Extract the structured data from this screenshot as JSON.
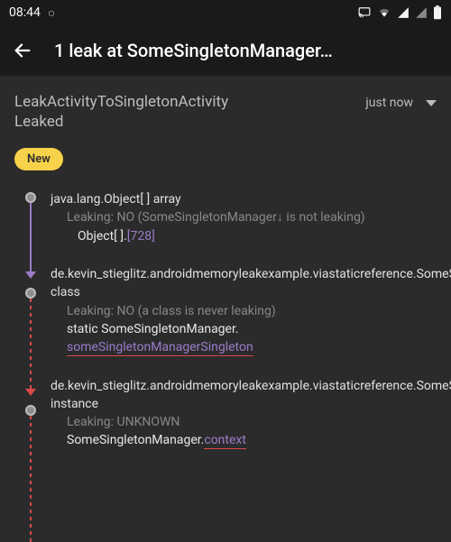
{
  "status": {
    "time": "08:44",
    "dot": "○"
  },
  "appbar": {
    "title": "1 leak at SomeSingletonManager…"
  },
  "header": {
    "line1": "LeakActivityToSingletonActivity",
    "line2": "Leaked",
    "time": "just now"
  },
  "badge": {
    "label": "New"
  },
  "trace": [
    {
      "line1": "java.lang.Object[ ] array",
      "leaking": "Leaking: NO (SomeSingletonManager↓ is not leaking)",
      "sig_prefix": "Object[ ].",
      "sig_highlight": "[728]"
    },
    {
      "line1": "de.kevin_stieglitz.androidmemoryleakexample.viastaticreference.SomeSingletonManager class",
      "leaking": "Leaking: NO (a class is never leaking)",
      "sig_prefix": "static SomeSingletonManager.",
      "sig_highlight": "someSingletonManagerSingleton"
    },
    {
      "line1": "de.kevin_stieglitz.androidmemoryleakexample.viastaticreference.SomeSingletonManager instance",
      "leaking": "Leaking: UNKNOWN",
      "sig_prefix": "SomeSingletonManager.",
      "sig_highlight": "context"
    }
  ]
}
